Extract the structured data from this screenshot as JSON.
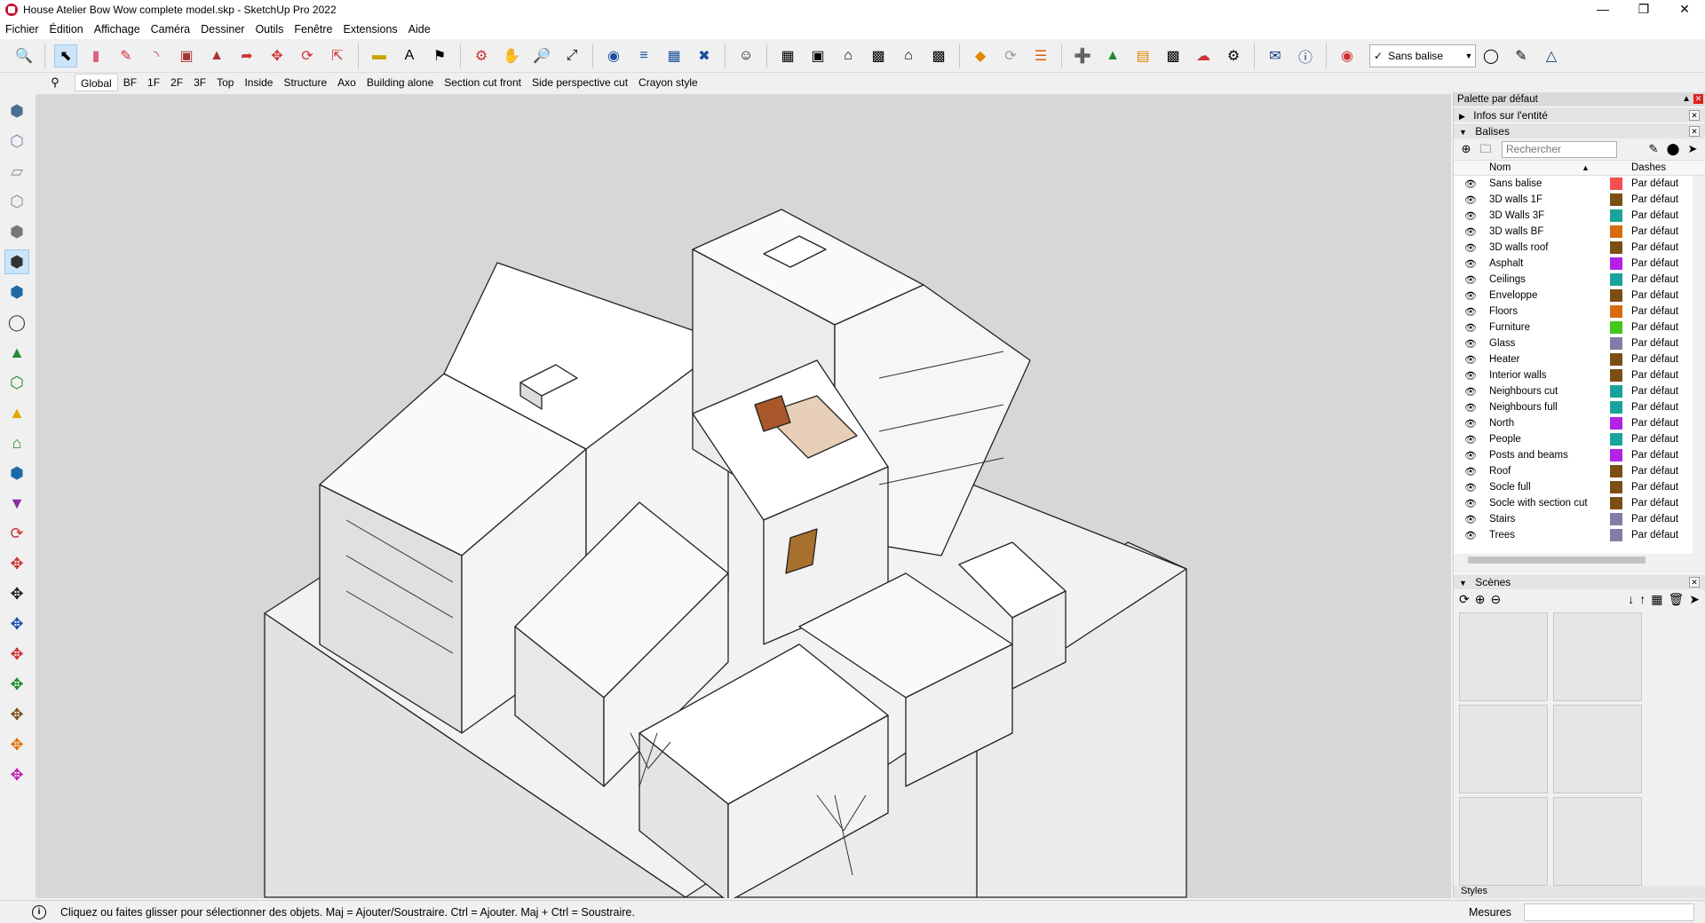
{
  "window": {
    "title": "House Atelier Bow Wow complete model.skp - SketchUp Pro 2022",
    "minimize": "—",
    "restore": "❐",
    "close": "✕"
  },
  "menu": [
    "Fichier",
    "Édition",
    "Affichage",
    "Caméra",
    "Dessiner",
    "Outils",
    "Fenêtre",
    "Extensions",
    "Aide"
  ],
  "toolbar": {
    "tag_selector_value": "Sans balise"
  },
  "scene_tabs": [
    "Global",
    "BF",
    "1F",
    "2F",
    "3F",
    "Top",
    "Inside",
    "Structure",
    "Axo",
    "Building alone",
    "Section cut front",
    "Side perspective cut",
    "Crayon style"
  ],
  "active_scene_tab": "Global",
  "tray": {
    "title": "Palette par défaut",
    "entity_info": "Infos sur l'entité",
    "tags_title": "Balises",
    "search_placeholder": "Rechercher",
    "col_name": "Nom",
    "col_dashes": "Dashes",
    "tags": [
      {
        "name": "Sans balise",
        "color": "#f05050",
        "dashes": "Par défaut"
      },
      {
        "name": "3D walls 1F",
        "color": "#7a4f12",
        "dashes": "Par défaut"
      },
      {
        "name": "3D Walls 3F",
        "color": "#1aa39a",
        "dashes": "Par défaut"
      },
      {
        "name": "3D walls BF",
        "color": "#d86a10",
        "dashes": "Par défaut"
      },
      {
        "name": "3D walls roof",
        "color": "#7a4f12",
        "dashes": "Par défaut"
      },
      {
        "name": "Asphalt",
        "color": "#b222e6",
        "dashes": "Par défaut"
      },
      {
        "name": "Ceilings",
        "color": "#1aa39a",
        "dashes": "Par défaut"
      },
      {
        "name": "Enveloppe",
        "color": "#7a4f12",
        "dashes": "Par défaut"
      },
      {
        "name": "Floors",
        "color": "#d86a10",
        "dashes": "Par défaut"
      },
      {
        "name": "Furniture",
        "color": "#44c61c",
        "dashes": "Par défaut"
      },
      {
        "name": "Glass",
        "color": "#7e7ea6",
        "dashes": "Par défaut"
      },
      {
        "name": "Heater",
        "color": "#7a4f12",
        "dashes": "Par défaut"
      },
      {
        "name": "Interior walls",
        "color": "#7a4f12",
        "dashes": "Par défaut"
      },
      {
        "name": "Neighbours cut",
        "color": "#1aa39a",
        "dashes": "Par défaut"
      },
      {
        "name": "Neighbours full",
        "color": "#1aa39a",
        "dashes": "Par défaut"
      },
      {
        "name": "North",
        "color": "#b222e6",
        "dashes": "Par défaut"
      },
      {
        "name": "People",
        "color": "#1aa39a",
        "dashes": "Par défaut"
      },
      {
        "name": "Posts and beams",
        "color": "#b222e6",
        "dashes": "Par défaut"
      },
      {
        "name": "Roof",
        "color": "#7a4f12",
        "dashes": "Par défaut"
      },
      {
        "name": "Socle full",
        "color": "#7a4f12",
        "dashes": "Par défaut"
      },
      {
        "name": "Socle with section cut",
        "color": "#7a4f12",
        "dashes": "Par défaut"
      },
      {
        "name": "Stairs",
        "color": "#7e7ea6",
        "dashes": "Par défaut"
      },
      {
        "name": "Trees",
        "color": "#7e7ea6",
        "dashes": "Par défaut"
      }
    ],
    "scenes_title": "Scènes",
    "styles_title": "Styles"
  },
  "status": {
    "hint": "Cliquez ou faites glisser pour sélectionner des objets. Maj = Ajouter/Soustraire. Ctrl = Ajouter. Maj + Ctrl = Soustraire.",
    "measurements_label": "Mesures"
  }
}
